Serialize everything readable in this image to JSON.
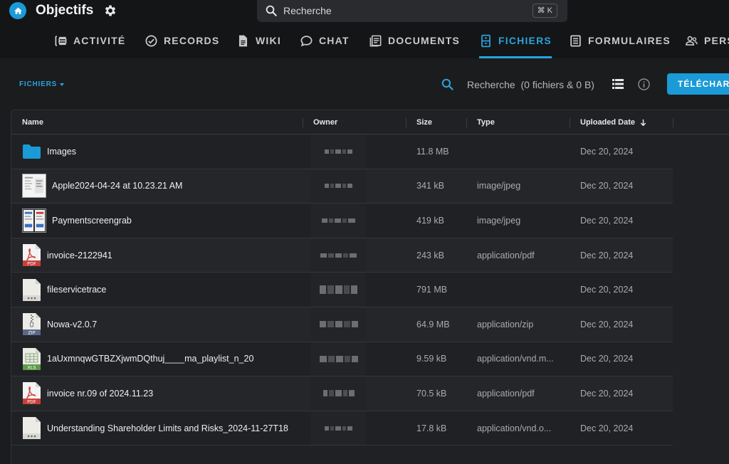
{
  "header": {
    "title": "Objectifs",
    "search_placeholder": "Recherche",
    "shortcut": "⌘ K"
  },
  "tabs": [
    {
      "label": "ACTIVITÉ",
      "icon": "activity-icon"
    },
    {
      "label": "RECORDS",
      "icon": "check-circle-icon"
    },
    {
      "label": "WIKI",
      "icon": "document-icon"
    },
    {
      "label": "CHAT",
      "icon": "chat-bubble-icon"
    },
    {
      "label": "DOCUMENTS",
      "icon": "documents-icon"
    },
    {
      "label": "FICHIERS",
      "icon": "file-cabinet-icon",
      "active": true
    },
    {
      "label": "FORMULAIRES",
      "icon": "form-icon"
    },
    {
      "label": "PERS",
      "icon": "people-icon"
    }
  ],
  "toolbar": {
    "breadcrumb": "FICHIERS",
    "search_text": "Recherche",
    "search_stats": "(0 fichiers & 0 B)",
    "upload_label": "TÉLÉCHAR"
  },
  "table": {
    "columns": {
      "name": "Name",
      "owner": "Owner",
      "size": "Size",
      "type": "Type",
      "uploaded": "Uploaded Date"
    },
    "rows": [
      {
        "name": "Images",
        "icon": "folder-icon",
        "size": "11.8 MB",
        "type": "",
        "date": "Dec 20, 2024"
      },
      {
        "name": "Apple2024-04-24 at 10.23.21 AM",
        "icon": "image-thumbnail-icon",
        "size": "341 kB",
        "type": "image/jpeg",
        "date": "Dec 20, 2024"
      },
      {
        "name": "Paymentscreengrab",
        "icon": "image-thumbnail-icon",
        "size": "419 kB",
        "type": "image/jpeg",
        "date": "Dec 20, 2024"
      },
      {
        "name": "invoice-2122941",
        "icon": "pdf-file-icon",
        "badge": "PDF",
        "size": "243 kB",
        "type": "application/pdf",
        "date": "Dec 20, 2024"
      },
      {
        "name": "fileservicetrace",
        "icon": "generic-file-icon",
        "size": "791 MB",
        "type": "",
        "date": "Dec 20, 2024"
      },
      {
        "name": "Nowa-v2.0.7",
        "icon": "zip-file-icon",
        "badge": "ZIP",
        "size": "64.9 MB",
        "type": "application/zip",
        "date": "Dec 20, 2024"
      },
      {
        "name": "1aUxmnqwGTBZXjwmDQthuj____ma_playlist_n_20",
        "icon": "xls-file-icon",
        "badge": "XLS",
        "size": "9.59 kB",
        "type": "application/vnd.m...",
        "date": "Dec 20, 2024"
      },
      {
        "name": "invoice nr.09 of 2024.11.23",
        "icon": "pdf-file-icon",
        "badge": "PDF",
        "size": "70.5 kB",
        "type": "application/pdf",
        "date": "Dec 20, 2024"
      },
      {
        "name": "Understanding Shareholder Limits and Risks_2024-11-27T18",
        "icon": "generic-file-icon",
        "size": "17.8 kB",
        "type": "application/vnd.o...",
        "date": "Dec 20, 2024"
      }
    ]
  },
  "colors": {
    "accent": "#1a9ad6",
    "background": "#1b1c1e",
    "pdf_badge": "#c9403a",
    "zip_badge": "#5a6a86",
    "xls_badge": "#5f9b4a"
  }
}
